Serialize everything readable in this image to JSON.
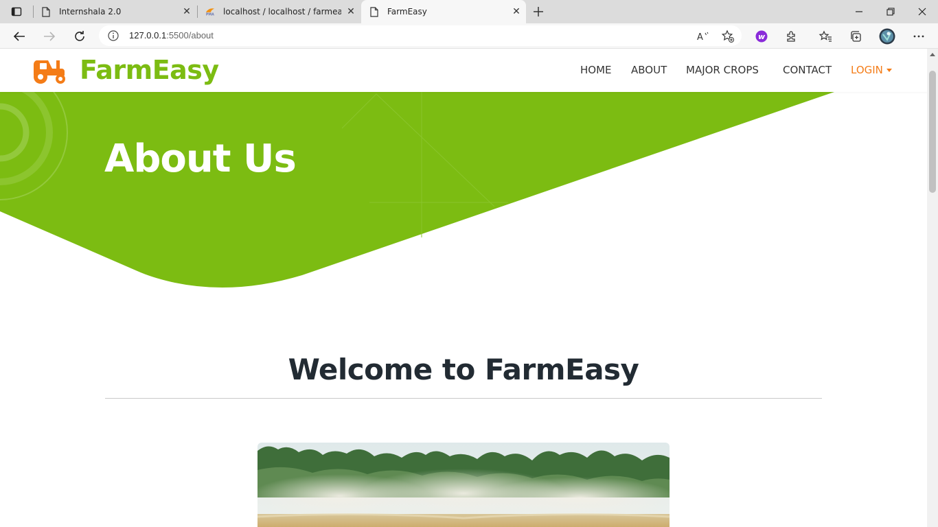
{
  "browser": {
    "tabs": [
      {
        "title": "Internshala 2.0",
        "favicon": "page-icon"
      },
      {
        "title": "localhost / localhost / farmeasy /",
        "favicon": "phpmyadmin-icon"
      },
      {
        "title": "FarmEasy",
        "favicon": "page-icon"
      }
    ],
    "active_tab": 2,
    "url_host": "127.0.0.1",
    "url_rest": ":5500/about"
  },
  "site": {
    "brand": "FarmEasy",
    "brand_color": "#7cbc12",
    "accent_color": "#f47c17",
    "nav": {
      "home": "HOME",
      "about": "ABOUT",
      "crops": "MAJOR CROPS",
      "contact": "CONTACT",
      "login": "LOGIN"
    },
    "hero_title": "About Us",
    "welcome_heading": "Welcome to FarmEasy"
  }
}
